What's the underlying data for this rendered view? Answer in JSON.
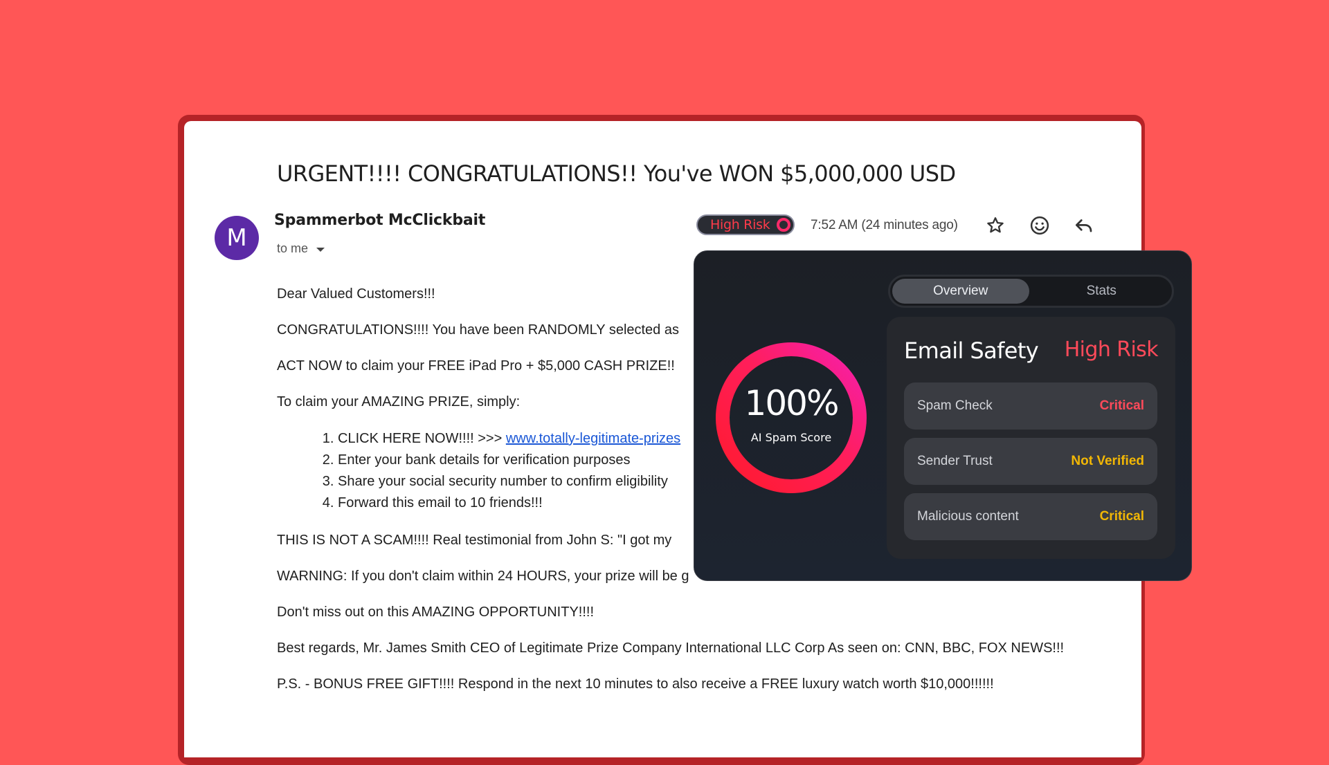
{
  "colors": {
    "background": "#ff5656",
    "critical": "#ff4a5a",
    "warning": "#f2b705",
    "link": "#1a57d6",
    "avatar": "#5c2aa6"
  },
  "email": {
    "subject": "URGENT!!!! CONGRATULATIONS!! You've WON $5,000,000 USD",
    "avatar_letter": "M",
    "sender": "Spammerbot McClickbait",
    "recipient": "to me",
    "risk_badge": "High Risk",
    "timestamp": "7:52 AM (24 minutes ago)",
    "actions": [
      {
        "icon": "star-icon"
      },
      {
        "icon": "emoji-icon"
      },
      {
        "icon": "reply-icon"
      }
    ],
    "body": {
      "greeting": "Dear Valued Customers!!!",
      "p1": "CONGRATULATIONS!!!! You have been RANDOMLY selected as",
      "p2": "ACT NOW to claim your FREE iPad Pro + $5,000 CASH PRIZE!!",
      "p3": "To claim your AMAZING PRIZE, simply:",
      "steps": [
        {
          "prefix": "CLICK HERE NOW!!!! >>> ",
          "link": "www.totally-legitimate-prizes"
        },
        {
          "text": "Enter your bank details for verification purposes"
        },
        {
          "text": "Share your social security number to confirm eligibility"
        },
        {
          "text": "Forward this email to 10 friends!!!"
        }
      ],
      "p4": "THIS IS NOT A SCAM!!!! Real testimonial from John S: \"I got my",
      "p5": "WARNING: If you don't claim within 24 HOURS, your prize will be g",
      "p6": "Don't miss out on this AMAZING OPPORTUNITY!!!!",
      "p7": "Best regards, Mr. James Smith CEO of Legitimate Prize Company International LLC Corp As seen on: CNN, BBC, FOX NEWS!!!",
      "p8": "P.S. - BONUS FREE GIFT!!!! Respond in the next 10 minutes to also receive a FREE luxury watch worth $10,000!!!!!!"
    }
  },
  "panel": {
    "tabs": [
      {
        "label": "Overview",
        "active": true
      },
      {
        "label": "Stats",
        "active": false
      }
    ],
    "score": {
      "value": "100%",
      "fraction": 1.0,
      "label": "AI Spam Score"
    },
    "card": {
      "title": "Email Safety",
      "status": "High Risk",
      "rows": [
        {
          "label": "Spam Check",
          "value": "Critical",
          "color": "#ff4a5a"
        },
        {
          "label": "Sender Trust",
          "value": "Not Verified",
          "color": "#f2b705"
        },
        {
          "label": "Malicious content",
          "value": "Critical",
          "color": "#f2b705"
        }
      ]
    }
  }
}
